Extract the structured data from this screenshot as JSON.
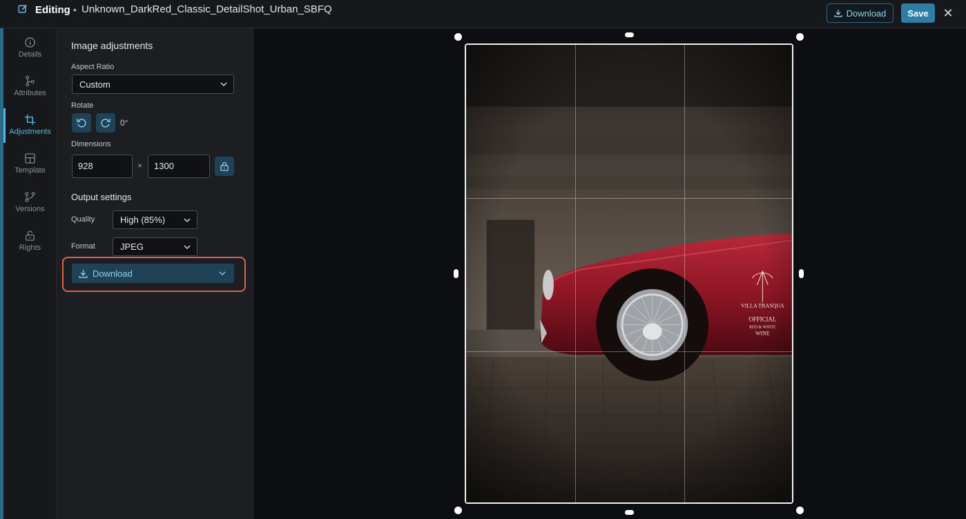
{
  "header": {
    "mode_label": "Editing",
    "separator": "•",
    "filename": "Unknown_DarkRed_Classic_DetailShot_Urban_SBFQ",
    "download_label": "Download",
    "save_label": "Save",
    "close_glyph": "✕"
  },
  "rail": {
    "items": [
      {
        "label": "Details",
        "icon": "info-icon"
      },
      {
        "label": "Attributes",
        "icon": "attributes-icon"
      },
      {
        "label": "Adjustments",
        "icon": "crop-icon",
        "active": true
      },
      {
        "label": "Template",
        "icon": "template-icon"
      },
      {
        "label": "Versions",
        "icon": "versions-icon"
      },
      {
        "label": "Rights",
        "icon": "lock-icon"
      }
    ]
  },
  "panel": {
    "title": "Image adjustments",
    "aspect_ratio": {
      "label": "Aspect Ratio",
      "value": "Custom"
    },
    "rotate": {
      "label": "Rotate",
      "value": "0°"
    },
    "dimensions": {
      "label": "Dimensions",
      "width": "928",
      "separator": "×",
      "height": "1300"
    },
    "output": {
      "title": "Output settings",
      "quality": {
        "label": "Quality",
        "value": "High (85%)"
      },
      "format": {
        "label": "Format",
        "value": "JPEG"
      }
    },
    "download_label": "Download"
  },
  "photo": {
    "sign_line1": "VILLA TRASQUA",
    "sign_line2": "OFFICIAL",
    "sign_line3": "RED & WHITE",
    "sign_line4": "WINE"
  },
  "colors": {
    "accent": "#59b8e3",
    "save": "#2e7ea3",
    "highlight": "#e0614a",
    "car": "#8e1624"
  }
}
